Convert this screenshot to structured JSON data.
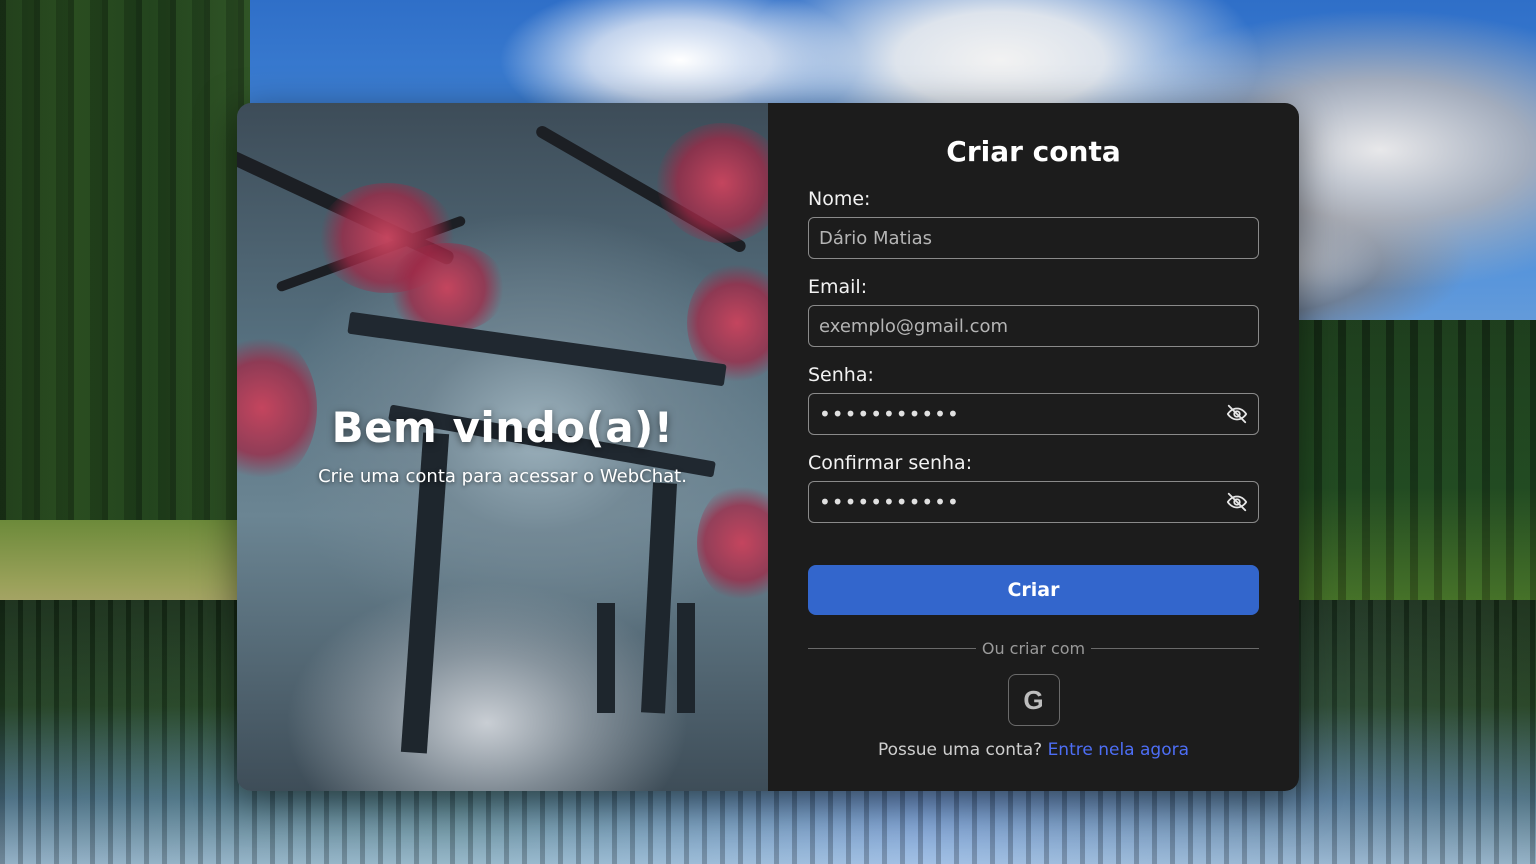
{
  "hero": {
    "title": "Bem vindo(a)!",
    "subtitle": "Crie uma conta para acessar o WebChat."
  },
  "form": {
    "title": "Criar conta",
    "name": {
      "label": "Nome:",
      "placeholder": "Dário Matias"
    },
    "email": {
      "label": "Email:",
      "placeholder": "exemplo@gmail.com"
    },
    "password": {
      "label": "Senha:",
      "value": "•••••••••••"
    },
    "confirm_password": {
      "label": "Confirmar senha:",
      "value": "•••••••••••"
    },
    "submit_label": "Criar",
    "divider_text": "Ou criar com",
    "google_label": "G",
    "login_prompt": "Possue uma conta?",
    "login_link": "Entre nela agora"
  },
  "colors": {
    "panel_bg": "#1c1c1c",
    "primary": "#3366cc",
    "link": "#4d6ef5"
  },
  "icons": [
    "eye-off-icon",
    "google-icon"
  ]
}
